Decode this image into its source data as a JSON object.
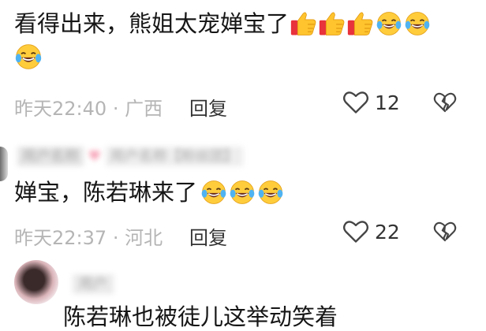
{
  "comments": [
    {
      "text": "看得出来，熊姐太宠婵宝了",
      "emojis": [
        "thumbs-up-icon",
        "thumbs-up-icon",
        "thumbs-up-icon",
        "laughing-crying-icon",
        "laughing-crying-icon",
        "laughing-crying-icon"
      ],
      "time": "昨天22:40",
      "location": "广西",
      "reply_label": "回复",
      "like_count": "12"
    },
    {
      "text": "婵宝，陈若琳来了",
      "emojis": [
        "laughing-crying-icon",
        "laughing-crying-icon",
        "laughing-crying-icon"
      ],
      "time": "昨天22:37",
      "location": "河北",
      "reply_label": "回复",
      "like_count": "22"
    },
    {
      "text": "陈若琳也被徒儿这举动笑着"
    }
  ],
  "separator": "·",
  "colors": {
    "meta_text": "#b5b5b5",
    "thumb_yellow": "#ffc42e",
    "cuff_red": "#e8323c"
  }
}
